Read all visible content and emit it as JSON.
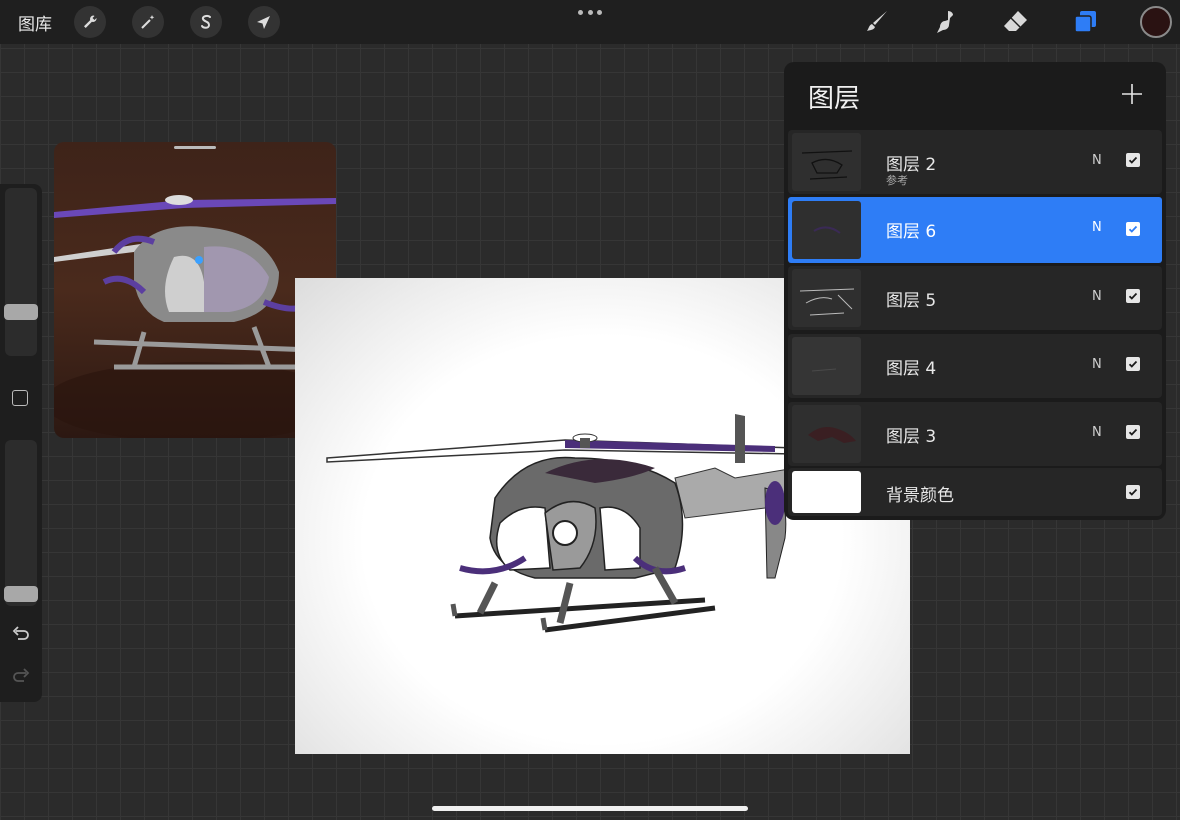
{
  "topbar": {
    "gallery_label": "图库",
    "tools": [
      "wrench-icon",
      "magic-wand-icon",
      "selection-icon",
      "transform-arrow-icon"
    ],
    "right_tools": [
      "brush-icon",
      "smudge-icon",
      "eraser-icon",
      "layers-icon"
    ],
    "active_color": "#2a1212",
    "accent": "#2e7df6"
  },
  "layers": {
    "title": "图层",
    "items": [
      {
        "name": "图层 2",
        "sub": "参考",
        "blend": "N",
        "visible": true,
        "active": false
      },
      {
        "name": "图层 6",
        "sub": "",
        "blend": "N",
        "visible": true,
        "active": true
      },
      {
        "name": "图层 5",
        "sub": "",
        "blend": "N",
        "visible": true,
        "active": false
      },
      {
        "name": "图层 4",
        "sub": "",
        "blend": "N",
        "visible": true,
        "active": false
      },
      {
        "name": "图层 3",
        "sub": "",
        "blend": "N",
        "visible": true,
        "active": false
      },
      {
        "name": "背景颜色",
        "sub": "",
        "blend": "",
        "visible": true,
        "active": false
      }
    ]
  }
}
